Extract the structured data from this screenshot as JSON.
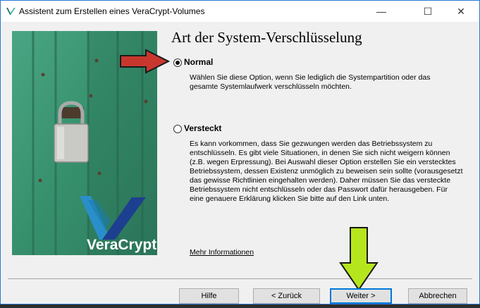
{
  "window": {
    "title": "Assistent zum Erstellen eines VeraCrypt-Volumes",
    "minimize_glyph": "—",
    "maximize_glyph": "☐",
    "close_glyph": "✕"
  },
  "brand": {
    "logo_text": "VeraCrypt"
  },
  "page": {
    "heading": "Art der System-Verschlüsselung"
  },
  "options": {
    "normal": {
      "label": "Normal",
      "selected": true,
      "description": "Wählen Sie diese Option, wenn Sie lediglich die Systempartition oder das gesamte Systemlaufwerk verschlüsseln möchten."
    },
    "hidden": {
      "label": "Versteckt",
      "selected": false,
      "description": "Es kann vorkommen, dass Sie gezwungen werden das Betriebssystem zu entschlüsseln. Es gibt viele Situationen, in denen Sie sich nicht weigern können (z.B. wegen Erpressung). Bei Auswahl dieser Option erstellen Sie ein verstecktes Betriebssystem, dessen Existenz unmöglich zu beweisen sein sollte (vorausgesetzt das gewisse Richtlinien eingehalten werden). Daher müssen Sie das versteckte Betriebssystem nicht entschlüsseln oder das Passwort dafür herausgeben. Für eine genauere Erklärung klicken Sie bitte auf den Link unten."
    }
  },
  "more_info_link": "Mehr Informationen",
  "buttons": {
    "help": "Hilfe",
    "back": "< Zurück",
    "next": "Weiter >",
    "cancel": "Abbrechen"
  },
  "colors": {
    "accent": "#0078d7",
    "arrow_red": "#c8372d",
    "arrow_green": "#b5e61d",
    "door_green": "#3f9d78"
  }
}
